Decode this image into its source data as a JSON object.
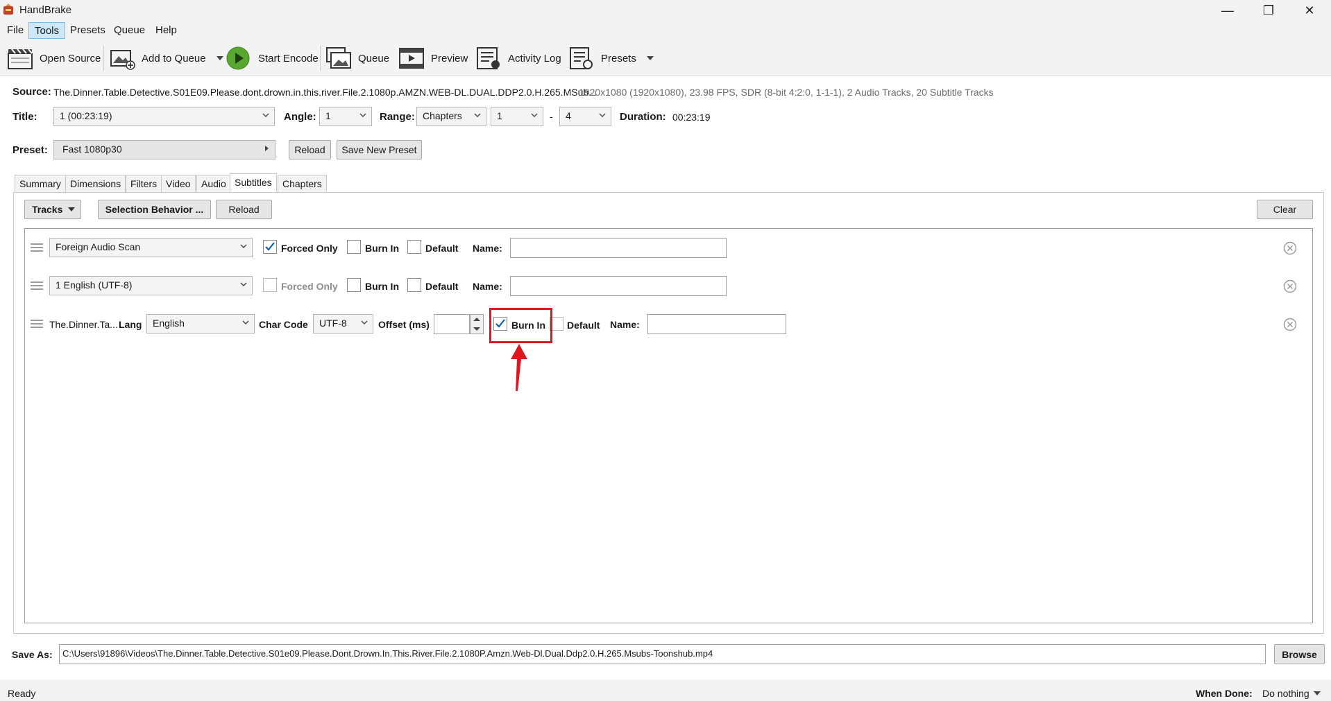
{
  "window": {
    "title": "HandBrake",
    "minimize_glyph": "—",
    "maximize_glyph": "❐",
    "close_glyph": "✕"
  },
  "menu": {
    "items": [
      "File",
      "Tools",
      "Presets",
      "Queue",
      "Help"
    ],
    "active": "Tools"
  },
  "toolbar": {
    "open_source": "Open Source",
    "add_to_queue": "Add to Queue",
    "start_encode": "Start Encode",
    "queue": "Queue",
    "preview": "Preview",
    "activity_log": "Activity Log",
    "presets": "Presets"
  },
  "source": {
    "label": "Source:",
    "name": "The.Dinner.Table.Detective.S01E09.Please.dont.drown.in.this.river.File.2.1080p.AMZN.WEB-DL.DUAL.DDP2.0.H.265.MSub...",
    "info": "1920x1080 (1920x1080), 23.98 FPS, SDR (8-bit 4:2:0, 1-1-1), 2 Audio Tracks, 20 Subtitle Tracks"
  },
  "title_row": {
    "title_label": "Title:",
    "title_value": "1  (00:23:19)",
    "angle_label": "Angle:",
    "angle_value": "1",
    "range_label": "Range:",
    "range_type": "Chapters",
    "range_start": "1",
    "range_sep": "-",
    "range_end": "4",
    "duration_label": "Duration:",
    "duration_value": "00:23:19"
  },
  "preset_row": {
    "label": "Preset:",
    "value": "Fast 1080p30",
    "reload": "Reload",
    "save_new": "Save New Preset"
  },
  "tabs": [
    "Summary",
    "Dimensions",
    "Filters",
    "Video",
    "Audio",
    "Subtitles",
    "Chapters"
  ],
  "selected_tab": "Subtitles",
  "subtitles": {
    "tracks_btn": "Tracks",
    "selection_behavior_btn": "Selection Behavior ...",
    "reload_btn": "Reload",
    "clear_btn": "Clear",
    "row1": {
      "track": "Foreign Audio Scan",
      "forced_only": "Forced Only",
      "forced_checked": true,
      "burn_in": "Burn In",
      "burn_checked": false,
      "default": "Default",
      "default_checked": false,
      "name_label": "Name:",
      "name_value": ""
    },
    "row2": {
      "track": "1 English (UTF-8)",
      "forced_only": "Forced Only",
      "forced_checked": false,
      "burn_in": "Burn In",
      "burn_checked": false,
      "default": "Default",
      "default_checked": false,
      "name_label": "Name:",
      "name_value": ""
    },
    "row3": {
      "file": "The.Dinner.Ta...",
      "lang_label": "Lang",
      "lang_value": "English",
      "char_code_label": "Char Code",
      "char_code_value": "UTF-8",
      "offset_label": "Offset (ms)",
      "offset_value": "",
      "burn_in": "Burn In",
      "burn_checked": true,
      "default": "Default",
      "default_checked": false,
      "name_label": "Name:",
      "name_value": ""
    }
  },
  "save_as": {
    "label": "Save As:",
    "path": "C:\\Users\\91896\\Videos\\The.Dinner.Table.Detective.S01e09.Please.Dont.Drown.In.This.River.File.2.1080P.Amzn.Web-Dl.Dual.Ddp2.0.H.265.Msubs-Toonshub.mp4",
    "browse": "Browse"
  },
  "status": {
    "text": "Ready",
    "when_done_label": "When Done:",
    "when_done_value": "Do nothing"
  },
  "colors": {
    "accent_highlight": "#e0161e",
    "checkmark": "#0a5fb0",
    "play_green": "#5aa832"
  }
}
